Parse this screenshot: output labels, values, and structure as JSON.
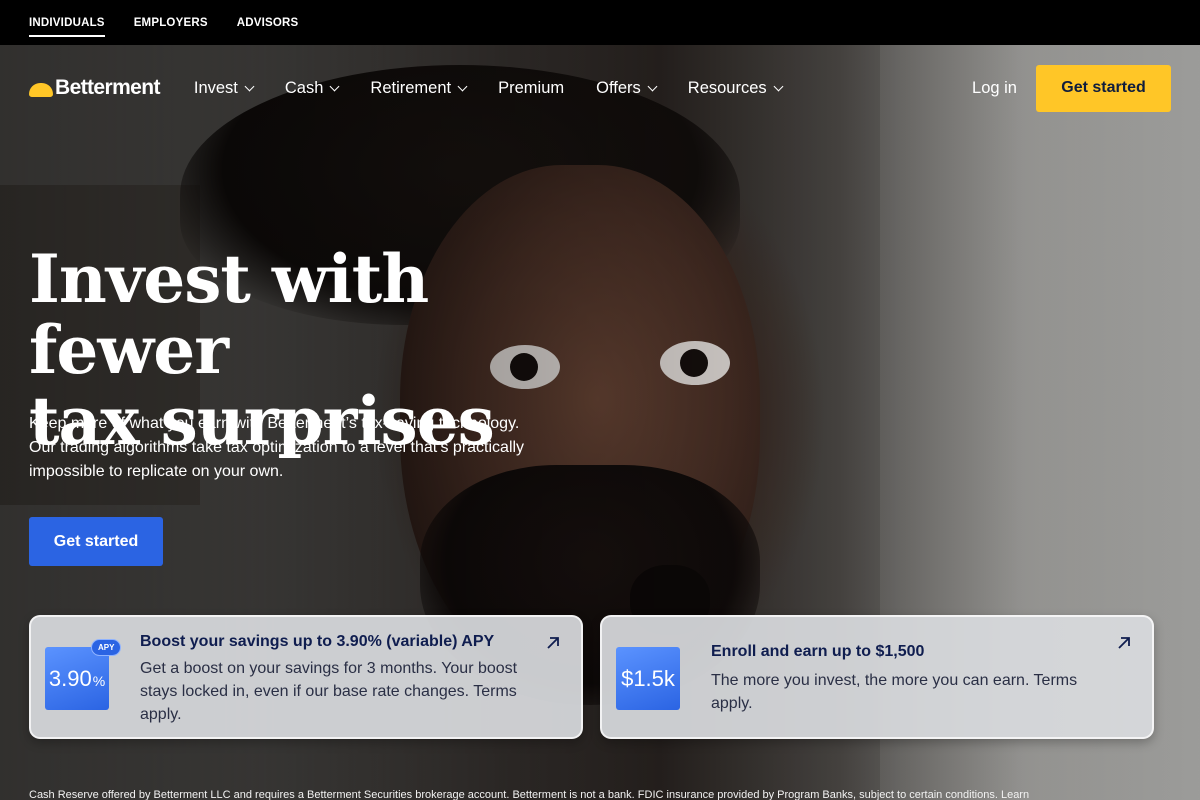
{
  "topbar": {
    "items": [
      {
        "label": "INDIVIDUALS",
        "active": true
      },
      {
        "label": "EMPLOYERS",
        "active": false
      },
      {
        "label": "ADVISORS",
        "active": false
      }
    ]
  },
  "nav": {
    "logo": "Betterment",
    "items": [
      {
        "label": "Invest",
        "dropdown": true
      },
      {
        "label": "Cash",
        "dropdown": true
      },
      {
        "label": "Retirement",
        "dropdown": true
      },
      {
        "label": "Premium",
        "dropdown": false
      },
      {
        "label": "Offers",
        "dropdown": true
      },
      {
        "label": "Resources",
        "dropdown": true
      }
    ],
    "login": "Log in",
    "cta": "Get started"
  },
  "hero": {
    "headline_line1": "Invest with fewer",
    "headline_line2": "tax surprises",
    "subcopy": "Keep more of what you earn with Betterment’s tax-saving technology. Our trading algorithms take tax optimization to a level that’s practically impossible to replicate on your own.",
    "cta": "Get started"
  },
  "cards": [
    {
      "badge_value": "3.90",
      "badge_suffix": "%",
      "badge_tag": "APY",
      "title": "Boost your savings up to 3.90% (variable) APY",
      "body": "Get a boost on your savings for 3 months. Your boost stays locked in, even if our base rate changes. Terms apply."
    },
    {
      "badge_value": "$1.5k",
      "title": "Enroll and earn up to $1,500",
      "body": "The more you invest, the more you can earn. Terms apply."
    }
  ],
  "disclaimer": "Cash Reserve offered by Betterment LLC and requires a Betterment Securities brokerage account. Betterment is not a bank. FDIC insurance provided by Program Banks, subject to certain conditions. Learn",
  "colors": {
    "brand_yellow": "#ffc627",
    "cta_blue": "#2b64e3",
    "navy_text": "#0f1d4f"
  }
}
